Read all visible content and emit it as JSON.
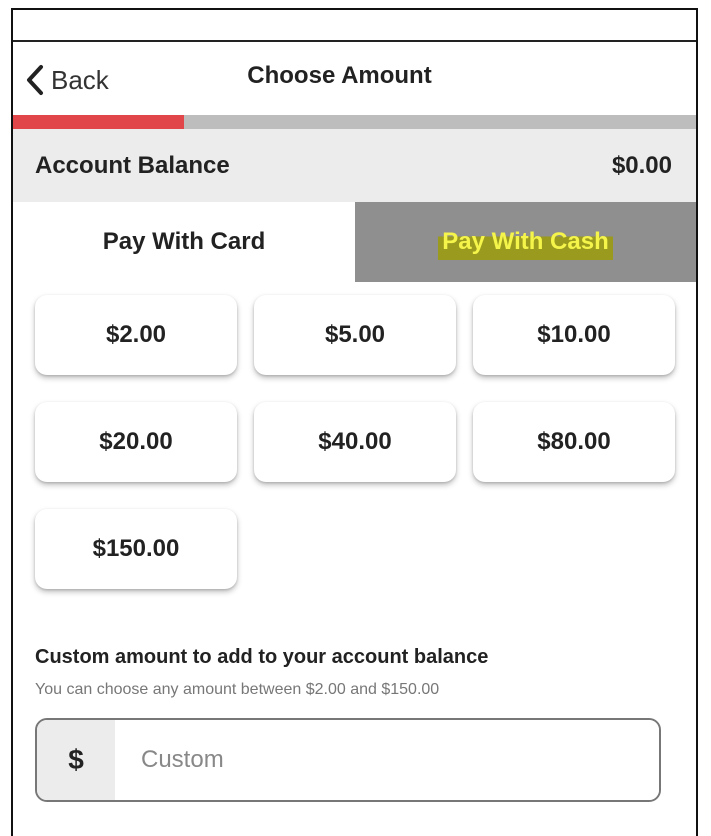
{
  "header": {
    "back_label": "Back",
    "title": "Choose Amount"
  },
  "progress": {
    "fraction": 0.25,
    "fill_color": "#e0464a",
    "track_color": "#bdbdbd"
  },
  "balance": {
    "label": "Account Balance",
    "value": "$0.00"
  },
  "tabs": [
    {
      "label": "Pay With Card",
      "selected": true
    },
    {
      "label": "Pay With Cash",
      "selected": false
    }
  ],
  "amounts": [
    "$2.00",
    "$5.00",
    "$10.00",
    "$20.00",
    "$40.00",
    "$80.00",
    "$150.00"
  ],
  "custom": {
    "title": "Custom amount to add to your account balance",
    "subtitle": "You can choose any amount between $2.00 and $150.00",
    "prefix": "$",
    "placeholder": "Custom",
    "value": ""
  },
  "icons": {
    "back": "chevron-left-icon"
  }
}
